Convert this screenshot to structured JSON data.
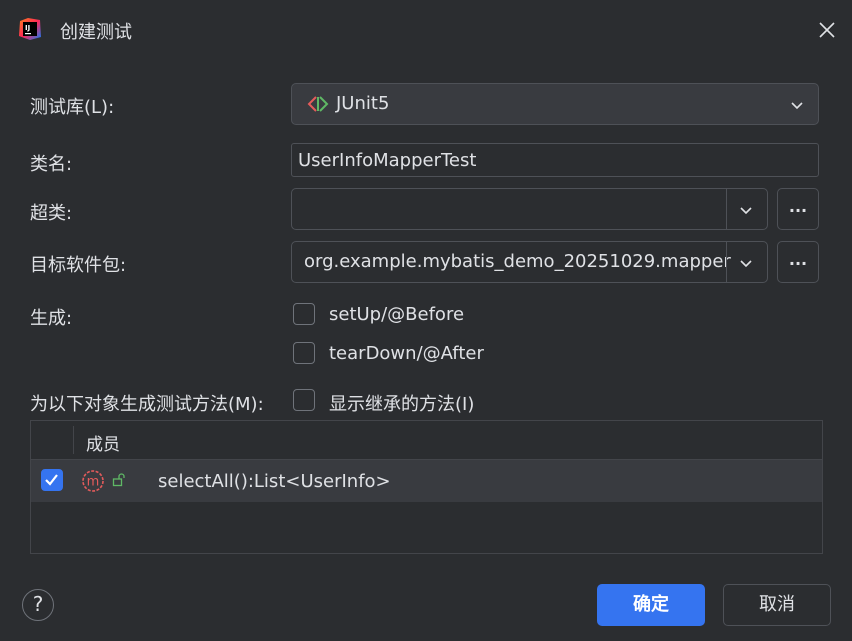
{
  "window": {
    "title": "创建测试"
  },
  "form": {
    "library_label": "测试库(L):",
    "library_value": "JUnit5",
    "classname_label": "类名:",
    "classname_value": "UserInfoMapperTest",
    "superclass_label": "超类:",
    "superclass_value": "",
    "package_label": "目标软件包:",
    "package_value": "org.example.mybatis_demo_20251029.mapper",
    "browse_label": "...",
    "generate_label": "生成:",
    "setup_label": "setUp/@Before",
    "setup_checked": false,
    "teardown_label": "tearDown/@After",
    "teardown_checked": false,
    "members_label": "为以下对象生成测试方法(M):",
    "inherited_label": "显示继承的方法(I)",
    "inherited_checked": false
  },
  "table": {
    "header": "成员",
    "rows": [
      {
        "checked": true,
        "icon": "method-icon",
        "visibility": "public-lock-icon",
        "text": "selectAll():List<UserInfo>"
      }
    ]
  },
  "footer": {
    "help": "?",
    "ok_label": "确定",
    "cancel_label": "取消"
  },
  "colors": {
    "background": "#2b2d30",
    "accent": "#3574f0",
    "border": "#4e5157",
    "selected_row": "#393b40"
  }
}
